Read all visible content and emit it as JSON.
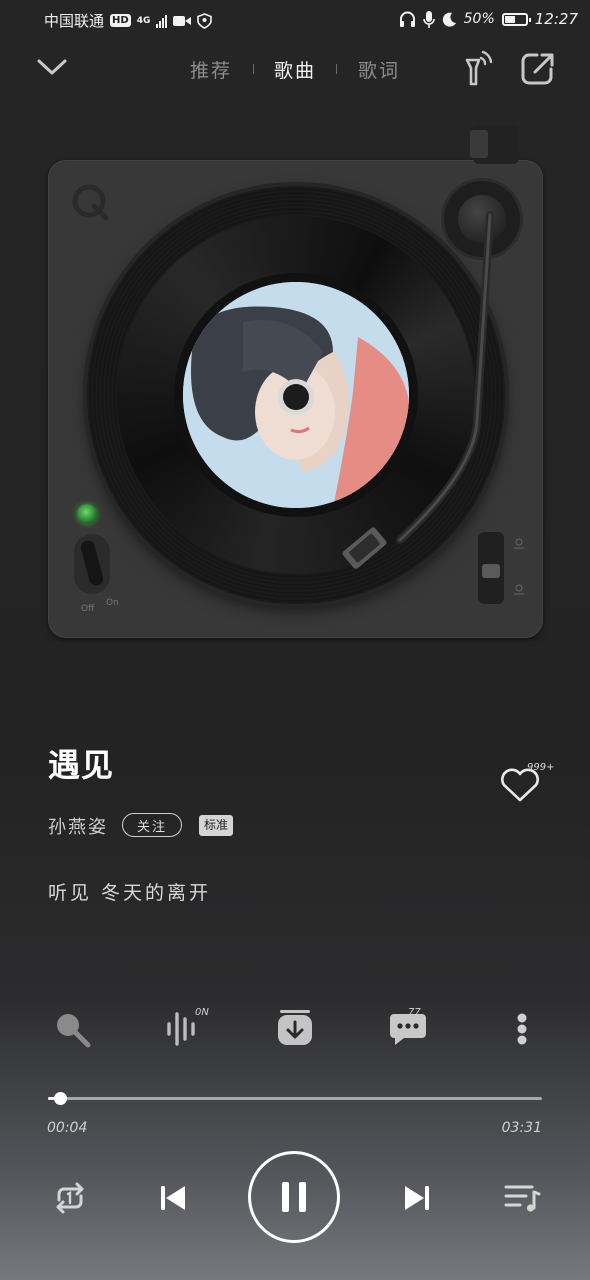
{
  "status_bar": {
    "carrier": "中国联通",
    "hd": "HD",
    "network": "4G",
    "battery": "50%",
    "battery_level": 0.5,
    "time": "12:27"
  },
  "nav": {
    "tabs": [
      {
        "label": "推荐",
        "active": false
      },
      {
        "label": "歌曲",
        "active": true
      },
      {
        "label": "歌词",
        "active": false
      }
    ]
  },
  "turntable": {
    "switch_off": "Off",
    "switch_on": "On"
  },
  "song": {
    "title": "遇见",
    "artist": "孙燕姿",
    "follow_label": "关注",
    "quality_badge": "标准",
    "lyric_line": "听见 冬天的离开",
    "like_count": "999+"
  },
  "actions": {
    "effect_badge": "0N",
    "comment_count": "77"
  },
  "playback": {
    "elapsed": "00:04",
    "duration": "03:31",
    "progress": 0.019
  },
  "colors": {
    "accent": "#ffffff",
    "background": "#232323"
  }
}
